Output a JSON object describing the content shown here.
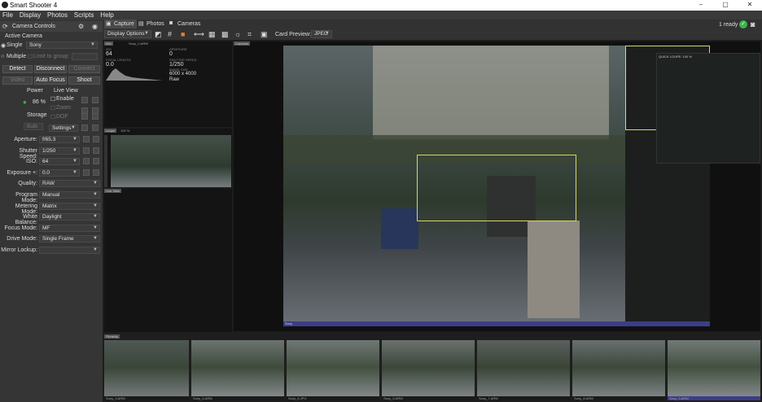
{
  "window": {
    "title": "Smart Shooter 4",
    "controls": [
      "–",
      "▢",
      "✕"
    ]
  },
  "menu": [
    "File",
    "Display",
    "Photos",
    "Scripts",
    "Help"
  ],
  "sidebar": {
    "header": "Camera Controls",
    "active_camera_label": "Active Camera",
    "single_label": "Single",
    "single_value": "Sony",
    "multiple_label": "Multiple",
    "multiple_value": "Limit to group:",
    "buttons_row1": [
      "Detect",
      "Disconnect",
      "Connect"
    ],
    "buttons_row2": [
      "Video",
      "Auto Focus",
      "Shoot"
    ],
    "power_label": "Power",
    "power_value": "86 %",
    "liveview_label": "Live View",
    "enable_label": "Enable",
    "zoom_label": "Zoom",
    "dof_label": "DOF",
    "storage_label": "Storage",
    "bulb_label": "Bulb",
    "settings_label": "Settings",
    "fields": [
      {
        "label": "Aperture:",
        "value": "f/65.3"
      },
      {
        "label": "Shutter Speed:",
        "value": "1/250"
      },
      {
        "label": "ISO:",
        "value": "64"
      },
      {
        "label": "Exposure +:",
        "value": "0.0"
      },
      {
        "label": "Quality:",
        "value": "RAW"
      },
      {
        "label": "Program Mode:",
        "value": "Manual"
      },
      {
        "label": "Metering Mode:",
        "value": "Matrix"
      },
      {
        "label": "White Balance:",
        "value": "Daylight"
      },
      {
        "label": "Focus Mode:",
        "value": "MF"
      },
      {
        "label": "Drive Mode:",
        "value": "Single Frame"
      },
      {
        "label": "Mirror Lockup:",
        "value": ""
      }
    ]
  },
  "toolbar": {
    "tabs": [
      "Capture",
      "Photos",
      "Cameras"
    ],
    "display_options": "Display Options",
    "card_preview_label": "Card Preview:",
    "card_preview_value": "JPEG",
    "status": "1 ready"
  },
  "info_panel": {
    "tag": "Info",
    "file": "Sony_0.ARW",
    "iso": "64",
    "aperture": "0",
    "shutter": "1/250",
    "size": "6000 x 4000",
    "quality": "Raw",
    "focal": "0.0"
  },
  "loupe_panel": {
    "tag": "Loupe",
    "zoom": "100 %"
  },
  "liveview_panel": {
    "tag": "Live View"
  },
  "main_view": {
    "tag": "Cameras",
    "bottom_label": "Sony",
    "loupe_tag": "QUICK LOUPE: 100 %"
  },
  "filmstrip": {
    "tag": "Filmstrip",
    "captions": [
      "Sony_3.ARW",
      "Sony_5.ARW",
      "Sony_6.JPG",
      "Sony_5.ARW",
      "Sony_7.ARW",
      "Sony_8.ARW",
      "Sony_9.ARW"
    ]
  },
  "colors": {
    "accent": "#4a9eda",
    "ready_green": "#3cb44b",
    "box_yellow": "#d8d860"
  }
}
